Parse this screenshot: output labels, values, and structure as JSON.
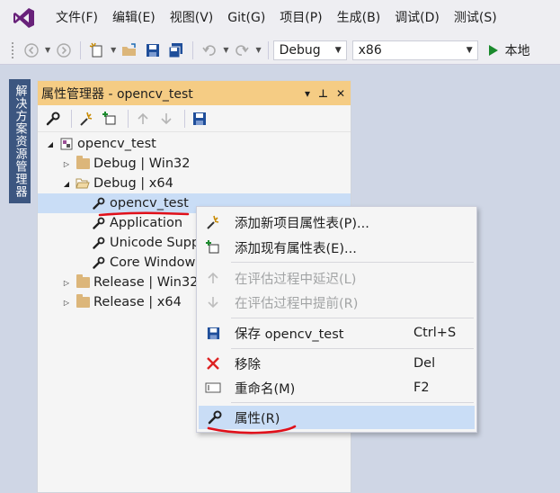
{
  "menubar": {
    "items": [
      "文件(F)",
      "编辑(E)",
      "视图(V)",
      "Git(G)",
      "项目(P)",
      "生成(B)",
      "调试(D)",
      "测试(S)"
    ]
  },
  "toolbar": {
    "config_value": "Debug",
    "platform_value": "x86",
    "run_label": "本地"
  },
  "side_tab": {
    "label": "解决方案资源管理器"
  },
  "panel": {
    "title": "属性管理器 - opencv_test",
    "title_buttons": [
      "▾",
      "⊥",
      "✕"
    ],
    "tree": [
      {
        "label": "opencv_test",
        "level": 0,
        "expander": "◢",
        "icon": "project-icon"
      },
      {
        "label": "Debug | Win32",
        "level": 1,
        "expander": "▷",
        "icon": "folder-icon"
      },
      {
        "label": "Debug | x64",
        "level": 1,
        "expander": "◢",
        "icon": "folder-open-icon"
      },
      {
        "label": "opencv_test",
        "level": 2,
        "expander": "",
        "icon": "wrench-icon",
        "selected": true
      },
      {
        "label": "Application",
        "level": 2,
        "expander": "",
        "icon": "wrench-icon"
      },
      {
        "label": "Unicode Supp",
        "level": 2,
        "expander": "",
        "icon": "wrench-icon"
      },
      {
        "label": "Core Window",
        "level": 2,
        "expander": "",
        "icon": "wrench-icon"
      },
      {
        "label": "Release | Win32",
        "level": 1,
        "expander": "▷",
        "icon": "folder-icon"
      },
      {
        "label": "Release | x64",
        "level": 1,
        "expander": "▷",
        "icon": "folder-icon"
      }
    ]
  },
  "context_menu": {
    "items": [
      {
        "label": "添加新项目属性表(P)...",
        "shortcut": "",
        "icon": "add-new-sheet-icon",
        "disabled": false
      },
      {
        "label": "添加现有属性表(E)...",
        "shortcut": "",
        "icon": "add-existing-sheet-icon",
        "disabled": false
      },
      {
        "label": "在评估过程中延迟(L)",
        "shortcut": "",
        "icon": "arrow-up-icon",
        "disabled": true
      },
      {
        "label": "在评估过程中提前(R)",
        "shortcut": "",
        "icon": "arrow-down-icon",
        "disabled": true
      },
      {
        "label": "保存 opencv_test",
        "shortcut": "Ctrl+S",
        "icon": "save-icon",
        "disabled": false
      },
      {
        "label": "移除",
        "shortcut": "Del",
        "icon": "delete-icon",
        "disabled": false
      },
      {
        "label": "重命名(M)",
        "shortcut": "F2",
        "icon": "rename-icon",
        "disabled": false
      },
      {
        "label": "属性(R)",
        "shortcut": "",
        "icon": "wrench-icon",
        "disabled": false,
        "highlighted": true
      }
    ]
  },
  "colors": {
    "accent": "#68217a",
    "panel_title_bg": "#f5cc84",
    "selection": "#c9ddf6",
    "side_tab": "#3c5680",
    "annotation_ink": "#e0101a"
  }
}
